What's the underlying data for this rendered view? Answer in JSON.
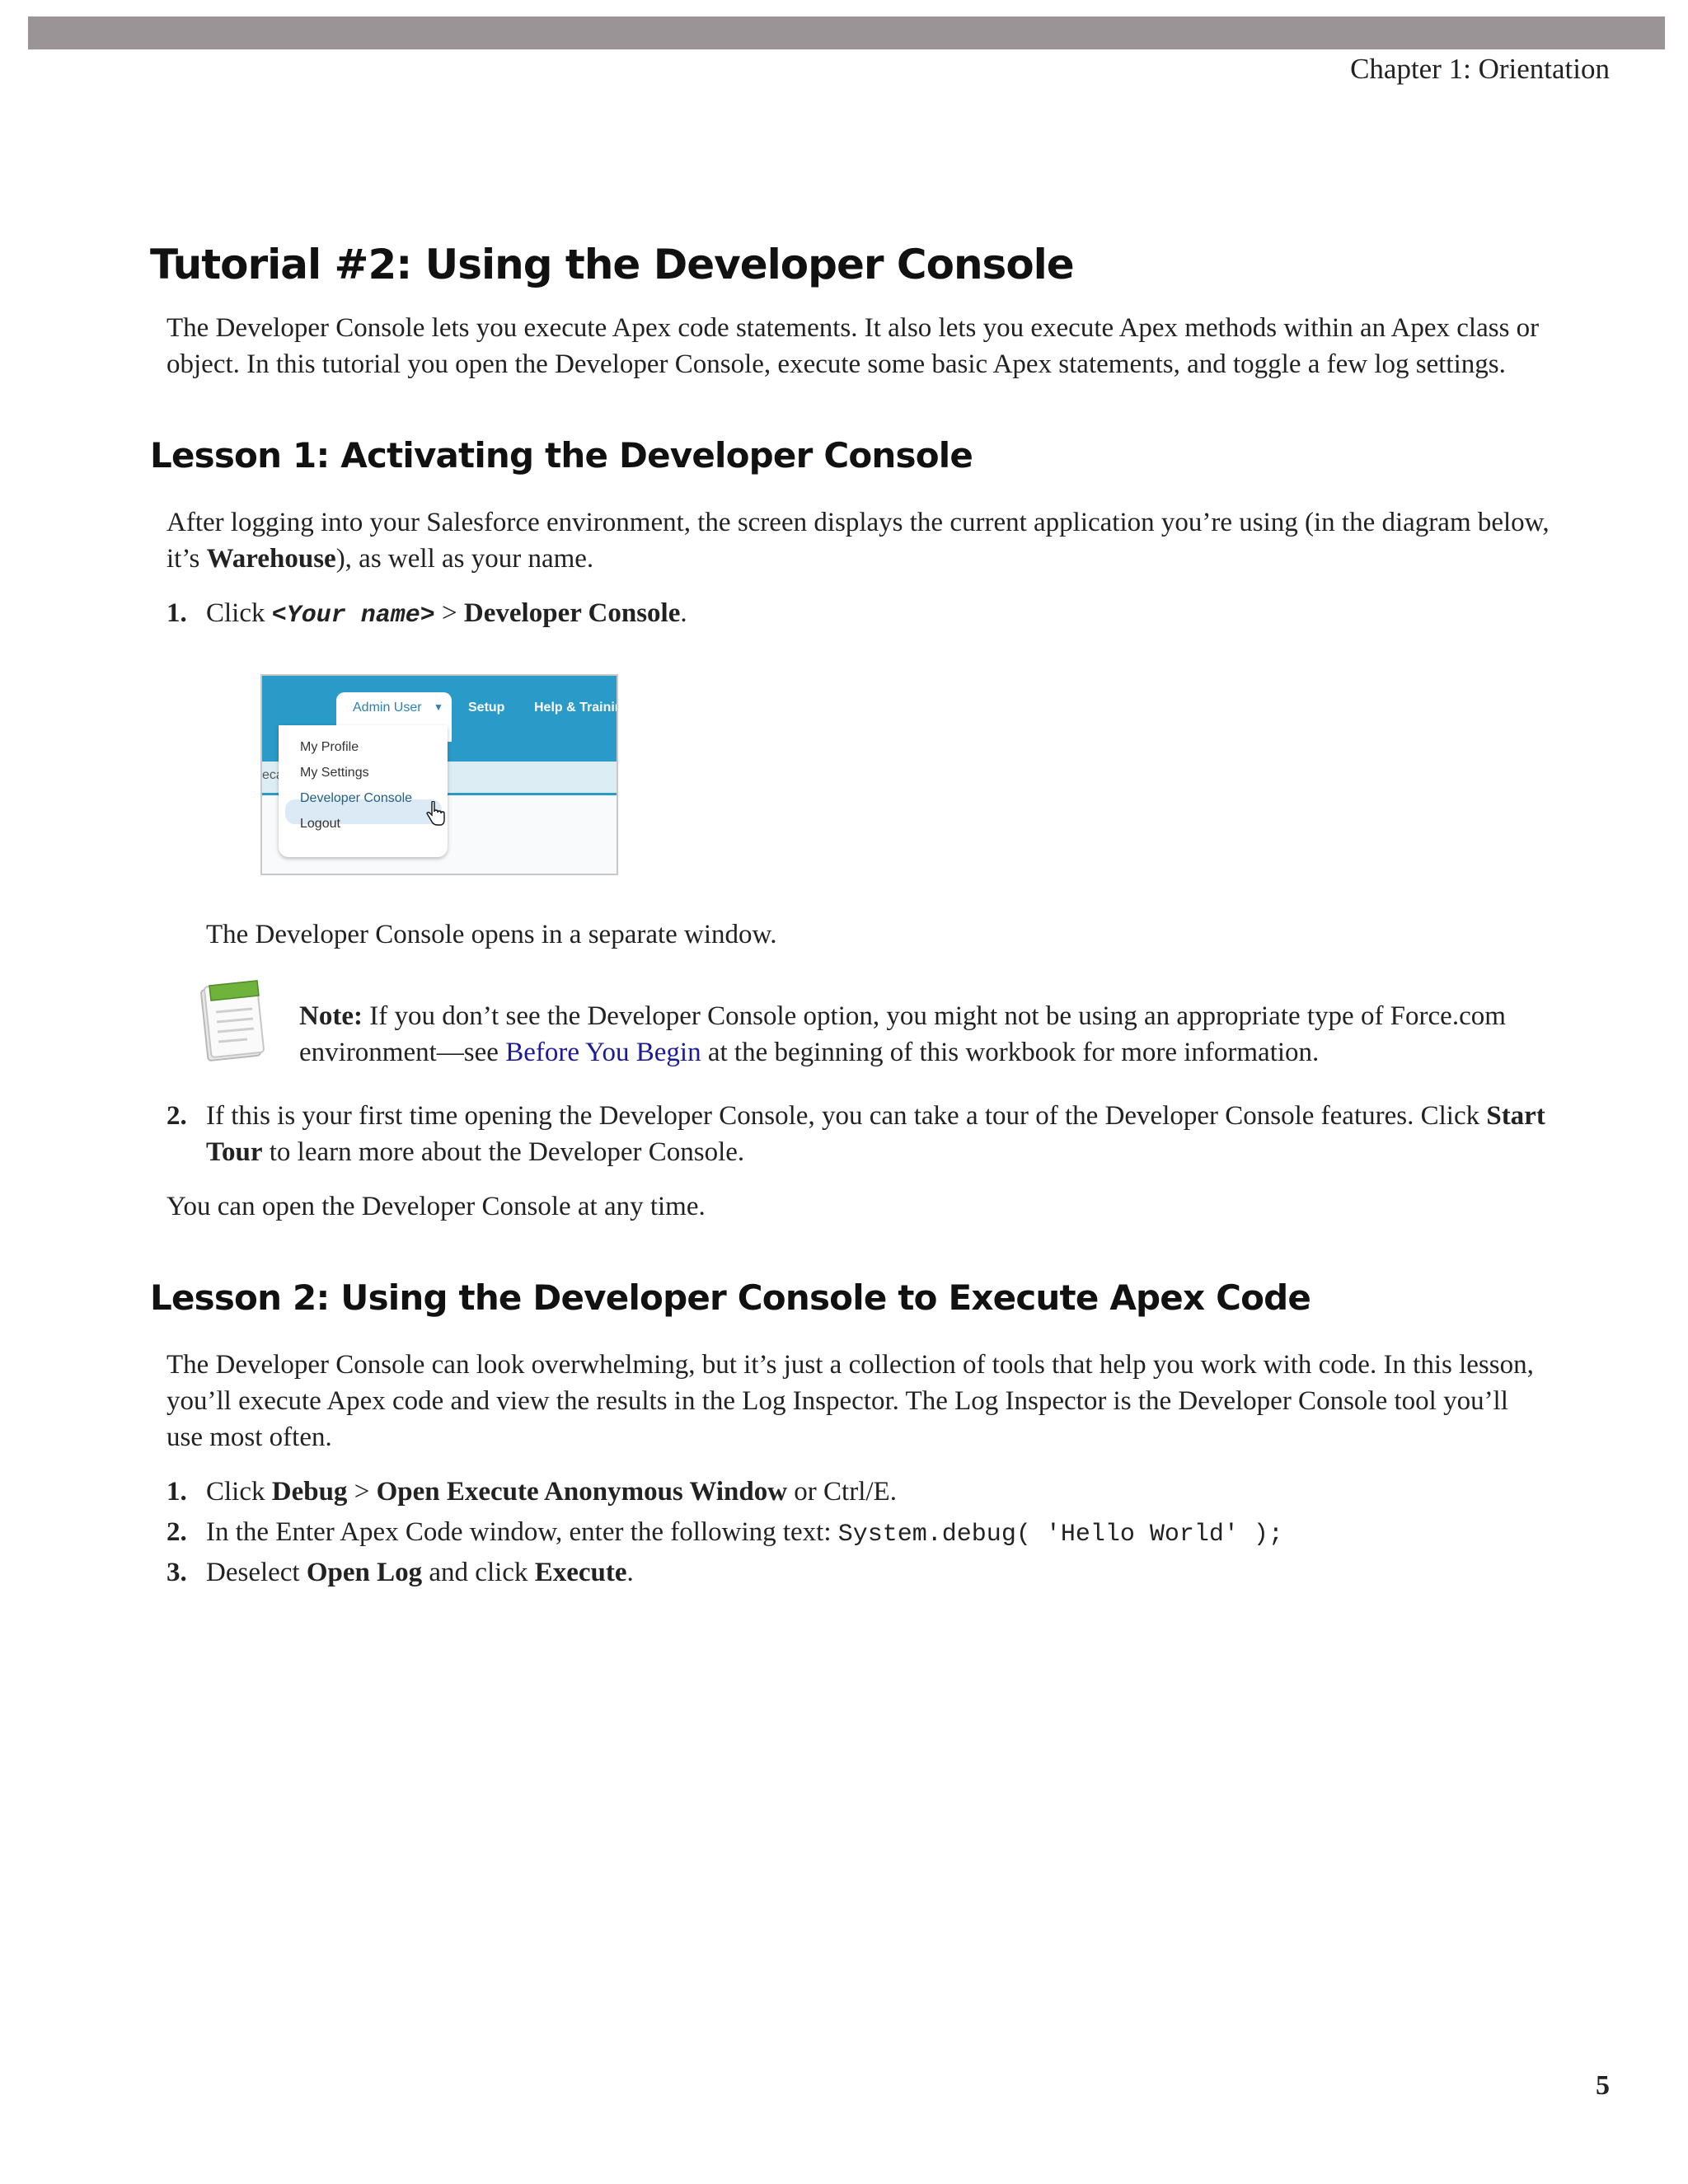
{
  "header": {
    "chapter": "Chapter 1: Orientation"
  },
  "tutorial": {
    "title": "Tutorial #2: Using the Developer Console",
    "intro": "The Developer Console lets you execute Apex code statements. It also lets you execute Apex methods within an Apex class or object. In this tutorial you open the Developer Console, execute some basic Apex statements, and toggle a few log settings."
  },
  "lesson1": {
    "title": "Lesson 1: Activating the Developer Console",
    "intro_pre": "After logging into your Salesforce environment, the screen displays the current application you’re using (in the diagram below, it’s ",
    "intro_bold": "Warehouse",
    "intro_post": "), as well as your name.",
    "step1": {
      "num": "1.",
      "pre": "Click ",
      "code": "<Your name>",
      "sep": " > ",
      "bold": "Developer Console",
      "post": "."
    },
    "figure": {
      "user_tab": "Admin User",
      "setup": "Setup",
      "help": "Help & Trainin",
      "side_fragment": "eca",
      "menu": [
        "My Profile",
        "My Settings",
        "Developer Console",
        "Logout"
      ]
    },
    "opens": "The Developer Console opens in a separate window.",
    "note": {
      "label": "Note:",
      "pre": " If you don’t see the Developer Console option, you might not be using an appropriate type of Force.com environment—see ",
      "link": "Before You Begin",
      "post": " at the beginning of this workbook for more information."
    },
    "step2": {
      "num": "2.",
      "pre": "If this is your first time opening the Developer Console, you can take a tour of the Developer Console features. Click ",
      "bold": "Start Tour",
      "post": " to learn more about the Developer Console."
    },
    "anytime": "You can open the Developer Console at any time."
  },
  "lesson2": {
    "title": "Lesson 2: Using the Developer Console to Execute Apex Code",
    "intro": "The Developer Console can look overwhelming, but it’s just a collection of tools that help you work with code. In this lesson, you’ll execute Apex code and view the results in the Log Inspector. The Log Inspector is the Developer Console tool you’ll use most often.",
    "step1": {
      "num": "1.",
      "pre": "Click ",
      "b1": "Debug",
      "sep": " > ",
      "b2": "Open Execute Anonymous Window",
      "post": " or Ctrl/E."
    },
    "step2": {
      "num": "2.",
      "pre": "In the Enter Apex Code window, enter the following text: ",
      "code": "System.debug( 'Hello World' );"
    },
    "step3": {
      "num": "3.",
      "pre": "Deselect ",
      "b1": "Open Log",
      "mid": " and click ",
      "b2": "Execute",
      "post": "."
    }
  },
  "footer": {
    "page": "5"
  }
}
